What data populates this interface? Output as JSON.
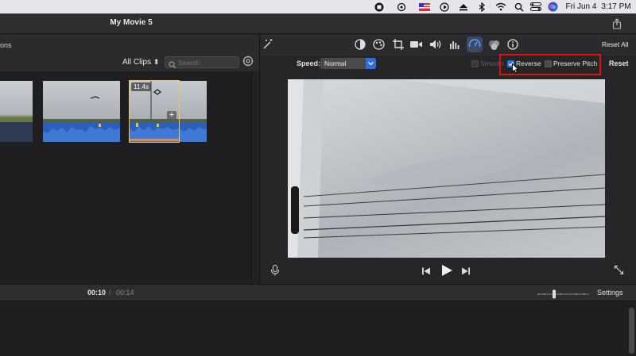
{
  "menubar": {
    "date": "Fri Jun 4",
    "time": "3:17 PM"
  },
  "window": {
    "title": "My Movie 5",
    "left_label": "ons"
  },
  "browser": {
    "filter_label": "All Clips",
    "search_placeholder": "Search",
    "clips": [
      {
        "name": "field-clip"
      },
      {
        "name": "sky-clip"
      },
      {
        "name": "selected-clip",
        "duration": "11.4s"
      },
      {
        "name": "sky-clip-2"
      }
    ]
  },
  "adjustments": {
    "reset_all": "Reset All",
    "speed_label": "Speed:",
    "speed_value": "Normal",
    "smooth_label": "Smooth",
    "reverse_label": "Reverse",
    "reverse_checked": true,
    "preserve_pitch_label": "Preserve Pitch",
    "preserve_pitch_checked": false,
    "reset_label": "Reset",
    "highlight_color": "#e01010",
    "accent": "#2f6fdc"
  },
  "timeline": {
    "current_time": "00:10",
    "separator": "/",
    "total_time": "00:14",
    "settings_label": "Settings"
  }
}
